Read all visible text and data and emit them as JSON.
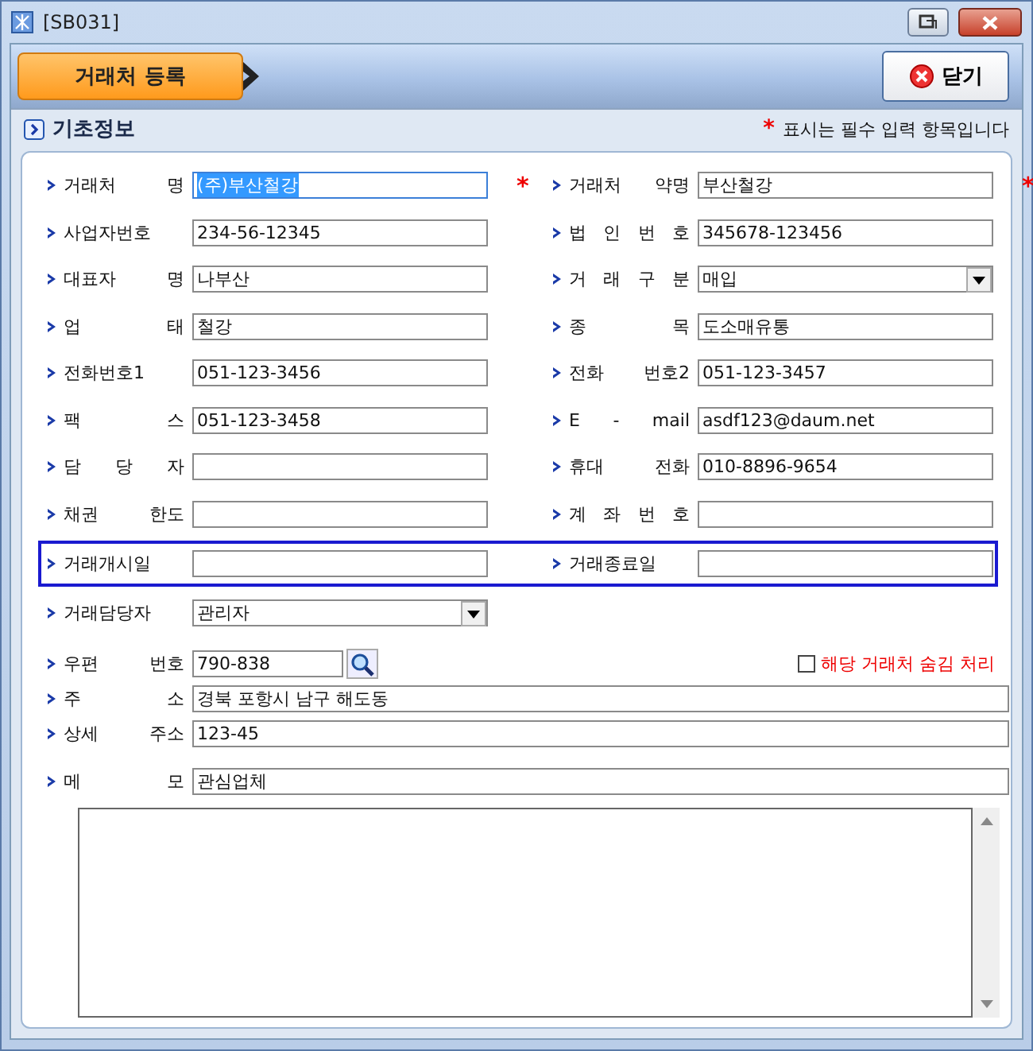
{
  "window": {
    "title": "[SB031]"
  },
  "toolbar": {
    "tab": {
      "label": "거래처 등록",
      "selected": true
    },
    "close_button": {
      "label": "닫기"
    }
  },
  "section": {
    "title": "기초정보",
    "required_mark": "*",
    "required_note": "표시는 필수 입력 항목입니다"
  },
  "rows": [
    {
      "highlighted": false,
      "left": {
        "label": "거래처 명",
        "value": "(주)부산철강",
        "kind": "text",
        "required": true,
        "value_selected": true
      },
      "right": {
        "label": "거래처 약명",
        "value": "부산철강",
        "kind": "text",
        "required": true,
        "value_selected": false
      }
    },
    {
      "highlighted": false,
      "left": {
        "label": "사업자번호",
        "value": "234-56-12345",
        "kind": "text",
        "required": false,
        "value_selected": false
      },
      "right": {
        "label": "법 인 번 호",
        "value": "345678-123456",
        "kind": "text",
        "required": false,
        "value_selected": false
      }
    },
    {
      "highlighted": false,
      "left": {
        "label": "대표자 명",
        "value": "나부산",
        "kind": "text",
        "required": false,
        "value_selected": false
      },
      "right": {
        "label": "거 래 구 분",
        "value": "매입",
        "kind": "dropdown",
        "required": false,
        "value_selected": false
      }
    },
    {
      "highlighted": false,
      "left": {
        "label": "업 태",
        "value": "철강",
        "kind": "text",
        "required": false,
        "value_selected": false
      },
      "right": {
        "label": "종 목",
        "value": "도소매유통",
        "kind": "text",
        "required": false,
        "value_selected": false
      }
    },
    {
      "highlighted": false,
      "left": {
        "label": "전화번호1",
        "value": "051-123-3456",
        "kind": "text",
        "required": false,
        "value_selected": false
      },
      "right": {
        "label": "전화 번호2",
        "value": "051-123-3457",
        "kind": "text",
        "required": false,
        "value_selected": false
      }
    },
    {
      "highlighted": false,
      "left": {
        "label": "팩 스",
        "value": "051-123-3458",
        "kind": "text",
        "required": false,
        "value_selected": false
      },
      "right": {
        "label": "E - mail",
        "value": "asdf123@daum.net",
        "kind": "text",
        "required": false,
        "value_selected": false
      }
    },
    {
      "highlighted": false,
      "left": {
        "label": "담 당 자",
        "kind": "text",
        "required": false,
        "value_selected": false
      },
      "right": {
        "label": "휴대 전화",
        "value": "010-8896-9654",
        "kind": "text",
        "required": false,
        "value_selected": false
      }
    },
    {
      "highlighted": false,
      "left": {
        "label": "채권 한도",
        "kind": "text",
        "required": false,
        "value_selected": false
      },
      "right": {
        "label": "계 좌 번 호",
        "kind": "text",
        "required": false,
        "value_selected": false
      }
    },
    {
      "highlighted": true,
      "left": {
        "label": "거래개시일",
        "kind": "text",
        "required": false,
        "value_selected": false
      },
      "right": {
        "label": "거래종료일",
        "kind": "text",
        "required": false,
        "value_selected": false
      }
    }
  ],
  "manager": {
    "label": "거래담당자",
    "value": "관리자"
  },
  "postal": {
    "label": "우편 번호",
    "value": "790-838"
  },
  "hide_option": {
    "label": "해당 거래처 숨김 처리",
    "checked": false
  },
  "address": {
    "label": "주 소",
    "value": "경북 포항시 남구 해도동"
  },
  "detail_address": {
    "label": "상세 주소",
    "value": "123-45"
  },
  "memo": {
    "label": "메 모",
    "value": "관심업체"
  }
}
